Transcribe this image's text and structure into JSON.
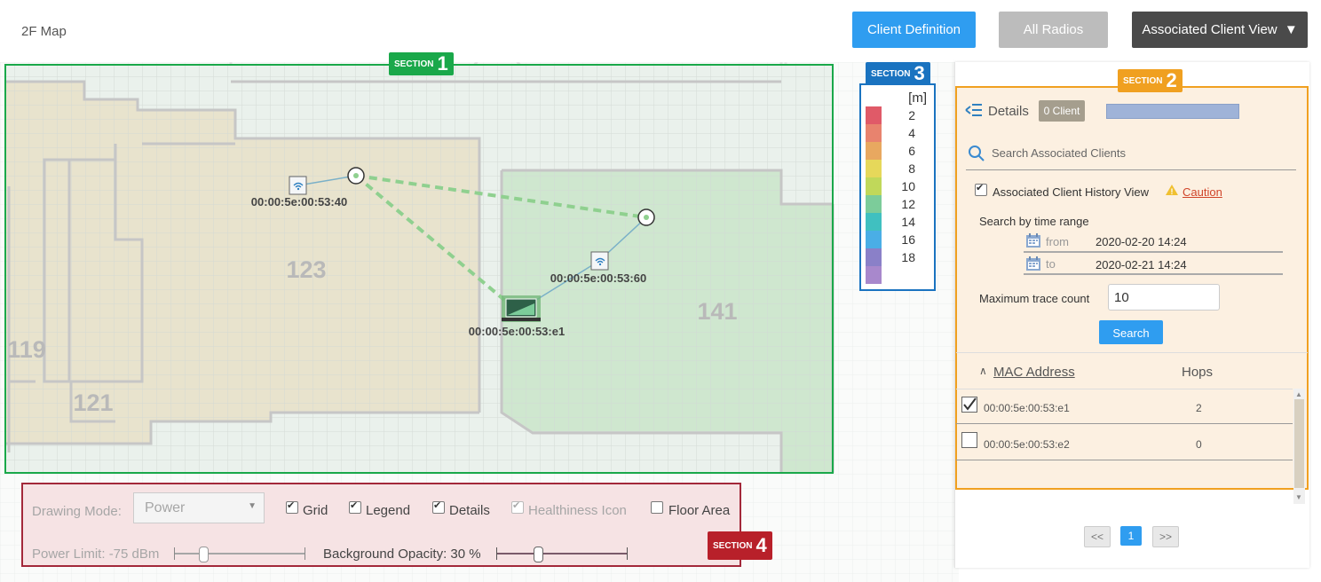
{
  "map_title": "2F Map",
  "header": {
    "client_definition": "Client Definition",
    "all_radios": "All Radios",
    "associated_view": "Associated Client View",
    "associated_view_caret": "▼"
  },
  "colors": {
    "primary_blue": "#2f9df0",
    "section1": "#1aa84a",
    "section2": "#f0a020",
    "section3": "#1a73c0",
    "section4": "#a3283a"
  },
  "sections": {
    "s1_small": "SECTION",
    "s1_num": "1",
    "s2_small": "SECTION",
    "s2_num": "2",
    "s3_small": "SECTION",
    "s3_num": "3",
    "s4_small": "SECTION",
    "s4_num": "4"
  },
  "rooms": {
    "r123": "123",
    "r141": "141",
    "r119": "119",
    "r121": "121"
  },
  "devices": {
    "ap1": "00:00:5e:00:53:40",
    "ap2": "00:00:5e:00:53:60",
    "client": "00:00:5e:00:53:e1"
  },
  "legend": {
    "unit": "[m]",
    "items": [
      {
        "value": "2",
        "color": "#e05a68"
      },
      {
        "value": "4",
        "color": "#e8836e"
      },
      {
        "value": "6",
        "color": "#e8a860"
      },
      {
        "value": "8",
        "color": "#e6d85a"
      },
      {
        "value": "10",
        "color": "#c0d85a"
      },
      {
        "value": "12",
        "color": "#7ccc9a"
      },
      {
        "value": "14",
        "color": "#40c0c0"
      },
      {
        "value": "16",
        "color": "#4aaee6"
      },
      {
        "value": "18",
        "color": "#8a80c8"
      },
      {
        "value": "",
        "color": "#a888cc"
      }
    ]
  },
  "panel": {
    "details_label": "Details",
    "client_badge": "0 Client",
    "search_placeholder": "Search Associated Clients",
    "history_label": "Associated Client History View",
    "caution": "Caution",
    "time_range_label": "Search by time range",
    "from_label": "from",
    "from_value": "2020-02-20 14:24",
    "to_label": "to",
    "to_value": "2020-02-21 14:24",
    "max_trace_label": "Maximum trace count",
    "max_trace_value": "10",
    "search_button": "Search",
    "col_mac": "MAC Address",
    "col_hops": "Hops",
    "rows": [
      {
        "mac": "00:00:5e:00:53:e1",
        "hops": "2",
        "checked": true
      },
      {
        "mac": "00:00:5e:00:53:e2",
        "hops": "0",
        "checked": false
      }
    ],
    "pager_prev": "<<",
    "pager_page": "1",
    "pager_next": ">>"
  },
  "controls": {
    "drawing_mode_label": "Drawing Mode:",
    "drawing_mode_value": "Power",
    "grid": "Grid",
    "legend": "Legend",
    "details": "Details",
    "healthiness": "Healthiness Icon",
    "floor_area": "Floor Area",
    "power_limit": "Power Limit: -75 dBm",
    "bg_opacity": "Background Opacity: 30 %"
  }
}
